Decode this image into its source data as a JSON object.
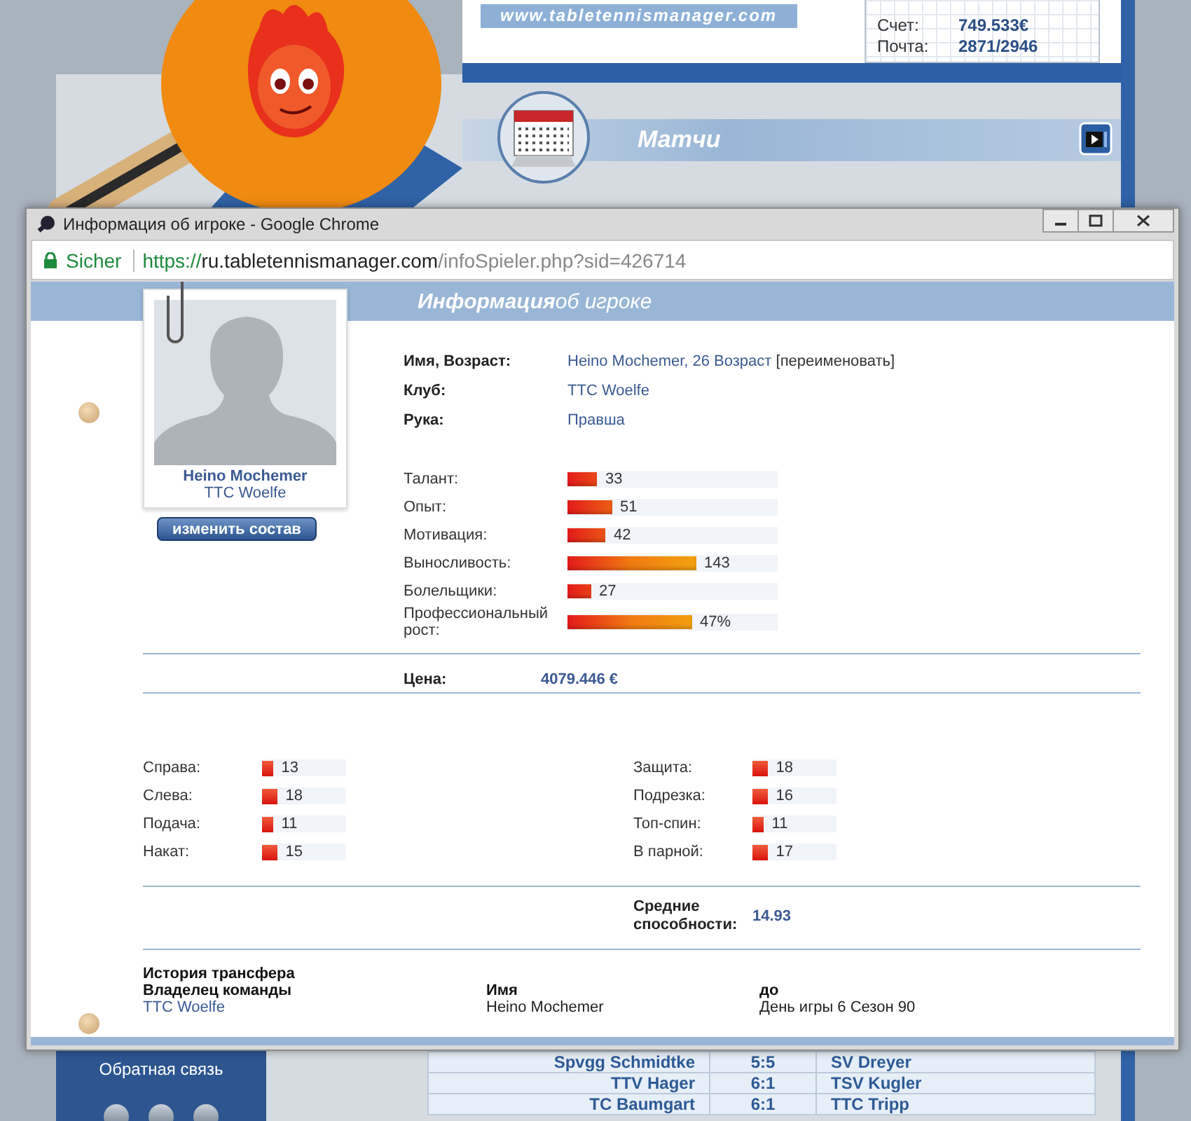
{
  "site": {
    "banner": "www.tabletennismanager.com",
    "account": [
      {
        "label": "Счет:",
        "value": "749.533€"
      },
      {
        "label": "Почта:",
        "value": "2871/2946"
      }
    ],
    "section_title": "Матчи",
    "sidebar": {
      "items": [
        "Обратная связь"
      ]
    },
    "matches": [
      {
        "home": "Spvgg Schmidtke",
        "score": "5:5",
        "away": "SV Dreyer"
      },
      {
        "home": "TTV Hager",
        "score": "6:1",
        "away": "TSV Kugler"
      },
      {
        "home": "TC Baumgart",
        "score": "6:1",
        "away": "TTC Tripp"
      }
    ]
  },
  "window": {
    "title": "Информация об игроке - Google Chrome",
    "security": "Sicher",
    "url": {
      "scheme": "https://",
      "host": "ru.tabletennismanager.com",
      "path": "/infoSpieler.php?sid=426714"
    }
  },
  "page": {
    "heading": "**Информация**об игроке",
    "player_card": {
      "name": "Heino Mochemer",
      "club": "TTC Woelfe",
      "button": "изменить состав"
    },
    "details": [
      {
        "label": "Имя, Возраст:",
        "value": "Heino Mochemer, 26 Возраст",
        "action": "[переименовать]"
      },
      {
        "label": "Клуб:",
        "value": "TTC Woelfe"
      },
      {
        "label": "Рука:",
        "value": "Правша"
      }
    ],
    "attributes": [
      {
        "label": "Талант:",
        "level": 0.14,
        "reading": "33"
      },
      {
        "label": "Опыт:",
        "level": 0.21,
        "reading": "51"
      },
      {
        "label": "Мотивация:",
        "level": 0.18,
        "reading": "42"
      },
      {
        "label": "Выносливость:",
        "level": 0.61,
        "reading": "143"
      },
      {
        "label": "Болельщики:",
        "level": 0.11,
        "reading": "27"
      },
      {
        "label": "Профессиональный рост:",
        "level": 0.59,
        "reading": "47%"
      }
    ],
    "price": {
      "label": "Цена:",
      "value": "4079.446 €"
    },
    "skills": {
      "left": [
        {
          "label": "Справа:",
          "level": 0.13,
          "reading": "13"
        },
        {
          "label": "Слева:",
          "level": 0.18,
          "reading": "18"
        },
        {
          "label": "Подача:",
          "level": 0.13,
          "reading": "11"
        },
        {
          "label": "Накат:",
          "level": 0.18,
          "reading": "15"
        }
      ],
      "right": [
        {
          "label": "Защита:",
          "level": 0.18,
          "reading": "18"
        },
        {
          "label": "Подрезка:",
          "level": 0.18,
          "reading": "16"
        },
        {
          "label": "Топ-спин:",
          "level": 0.13,
          "reading": "11"
        },
        {
          "label": "В парной:",
          "level": 0.18,
          "reading": "17"
        }
      ]
    },
    "average": {
      "label": "Средние способности:",
      "value": "14.93"
    },
    "transfer_history": {
      "title": "История трансфера",
      "columns": [
        "Владелец команды",
        "Имя",
        "до"
      ],
      "rows": [
        [
          "TTC Woelfe",
          "Heino Mochemer",
          "День игры 6 Сезон 90"
        ]
      ]
    }
  }
}
